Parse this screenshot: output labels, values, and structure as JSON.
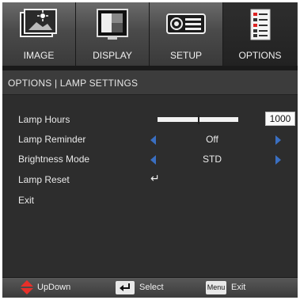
{
  "tabs": [
    {
      "label": "IMAGE",
      "icon": "image-icon",
      "active": false
    },
    {
      "label": "DISPLAY",
      "icon": "display-icon",
      "active": false
    },
    {
      "label": "SETUP",
      "icon": "setup-icon",
      "active": false
    },
    {
      "label": "OPTIONS",
      "icon": "options-icon",
      "active": true
    }
  ],
  "breadcrumb": "OPTIONS | LAMP SETTINGS",
  "rows": {
    "lamp_hours": {
      "label": "Lamp Hours",
      "value": "1000",
      "slider_level": 0.5
    },
    "lamp_reminder": {
      "label": "Lamp Reminder",
      "value": "Off"
    },
    "brightness_mode": {
      "label": "Brightness Mode",
      "value": "STD"
    },
    "lamp_reset": {
      "label": "Lamp Reset",
      "icon": "enter-icon"
    },
    "exit": {
      "label": "Exit"
    }
  },
  "footer": {
    "updown_label": "UpDown",
    "select_label": "Select",
    "menu_key": "Menu",
    "exit_label": "Exit"
  },
  "colors": {
    "accent_arrow": "#3a6fc2",
    "updown_arrow": "#e8302a"
  }
}
